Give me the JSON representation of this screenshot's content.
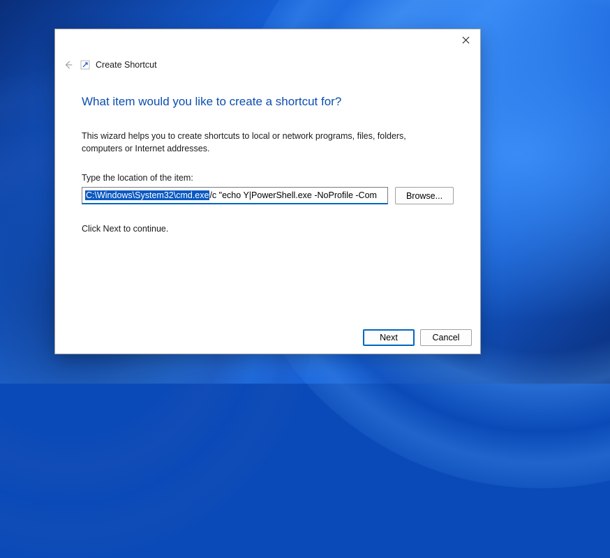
{
  "dialog": {
    "breadcrumb": "Create Shortcut",
    "heading": "What item would you like to create a shortcut for?",
    "description": "This wizard helps you to create shortcuts to local or network programs, files, folders, computers or Internet addresses.",
    "field_label": "Type the location of the item:",
    "location_selected": "C:\\Windows\\System32\\cmd.exe",
    "location_rest": " /c \"echo Y|PowerShell.exe -NoProfile -Com",
    "browse_label": "Browse...",
    "continue_text": "Click Next to continue.",
    "buttons": {
      "next": "Next",
      "cancel": "Cancel"
    }
  }
}
